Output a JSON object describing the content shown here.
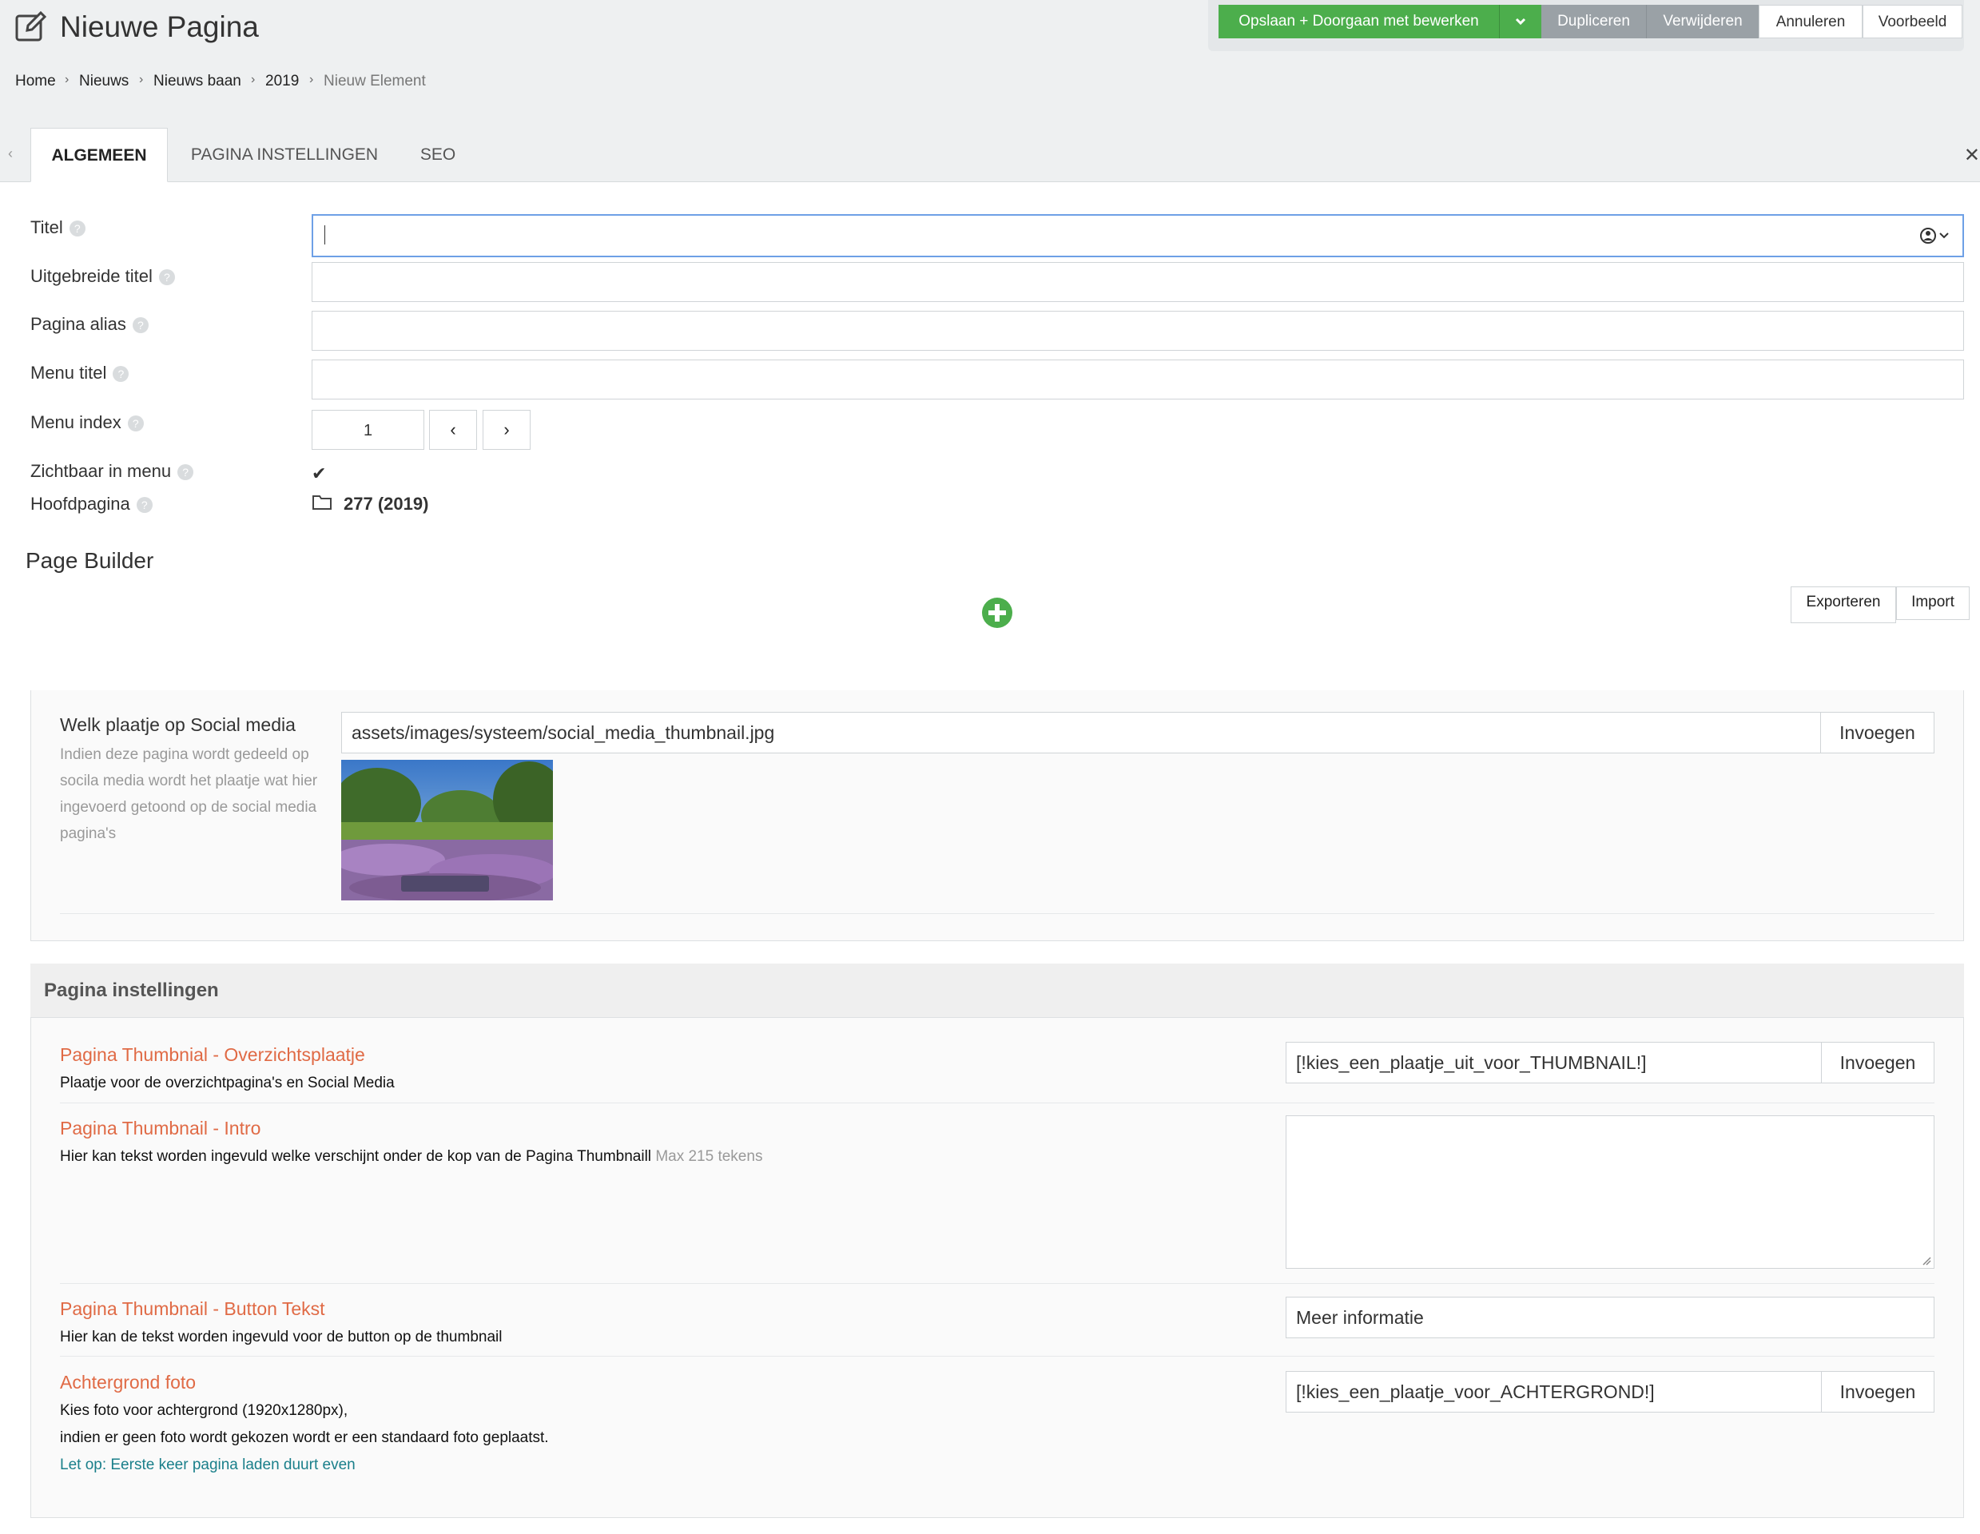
{
  "header": {
    "title": "Nieuwe Pagina",
    "actions": {
      "save": "Opslaan + Doorgaan met bewerken",
      "duplicate": "Dupliceren",
      "delete": "Verwijderen",
      "cancel": "Annuleren",
      "preview": "Voorbeeld"
    },
    "colors": {
      "save": "#4cae4c",
      "secondary": "#9aa1a6"
    }
  },
  "breadcrumb": [
    "Home",
    "Nieuws",
    "Nieuws baan",
    "2019",
    "Nieuw Element"
  ],
  "tabs": [
    {
      "label": "ALGEMEEN",
      "active": true
    },
    {
      "label": "PAGINA INSTELLINGEN",
      "active": false
    },
    {
      "label": "SEO",
      "active": false
    }
  ],
  "form": {
    "titel_label": "Titel",
    "uitgebreide_titel_label": "Uitgebreide titel",
    "alias_label": "Pagina alias",
    "menu_titel_label": "Menu titel",
    "menu_index_label": "Menu index",
    "menu_index_value": "1",
    "zichtbaar_label": "Zichtbaar in menu",
    "zichtbaar_checked": true,
    "hoofdpagina_label": "Hoofdpagina",
    "hoofdpagina_value": "277 (2019)"
  },
  "page_builder": {
    "title": "Page Builder",
    "export": "Exporteren",
    "import": "Import"
  },
  "social": {
    "title": "Welk plaatje op Social media",
    "description": "Indien deze pagina wordt gedeeld op socila media wordt het plaatje wat hier ingevoerd getoond op de social media pagina's",
    "value": "assets/images/systeem/social_media_thumbnail.jpg",
    "insert": "Invoegen"
  },
  "pagina_instellingen": {
    "title": "Pagina instellingen",
    "thumbnail": {
      "title": "Pagina Thumbnial - Overzichtsplaatje",
      "desc": "Plaatje voor de overzichtpagina's en Social Media",
      "value": "[!kies_een_plaatje_uit_voor_THUMBNAIL!]",
      "insert": "Invoegen"
    },
    "intro": {
      "title": "Pagina Thumbnail - Intro",
      "desc": "Hier kan tekst worden ingevuld welke verschijnt onder de kop van de Pagina Thumbnaill",
      "max": "Max 215 tekens"
    },
    "button_text": {
      "title": "Pagina Thumbnail - Button Tekst",
      "desc": "Hier kan de tekst worden ingevuld voor de button op de thumbnail",
      "value": "Meer informatie"
    },
    "background": {
      "title": "Achtergrond foto",
      "desc1": "Kies foto voor achtergrond (1920x1280px),",
      "desc2": "indien er geen foto wordt gekozen wordt er een standaard foto geplaatst.",
      "note": "Let op: Eerste keer pagina laden duurt even",
      "value": "[!kies_een_plaatje_voor_ACHTERGROND!]",
      "insert": "Invoegen"
    },
    "accent_color": "#e06a45"
  }
}
